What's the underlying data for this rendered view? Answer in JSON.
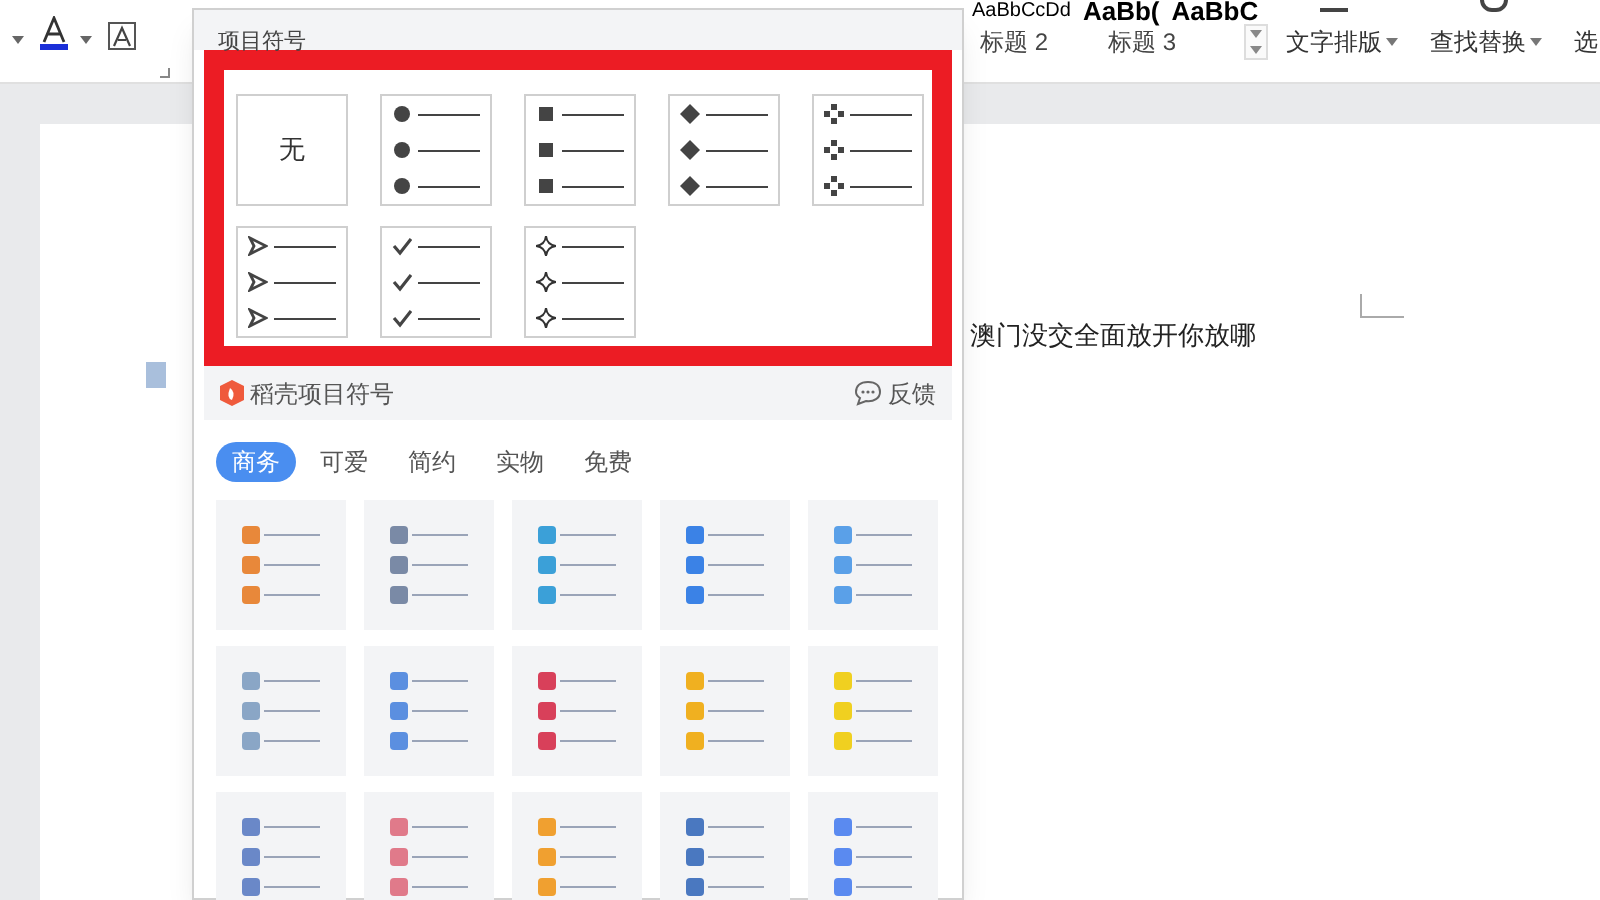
{
  "ribbon": {
    "style_previews": [
      "AaBbCcDd",
      "AaBb(",
      "AaBbC"
    ],
    "style_labels": [
      "标题 2",
      "标题 3"
    ],
    "buttons": [
      {
        "label": "文字排版"
      },
      {
        "label": "查找替换"
      },
      {
        "label": "选"
      }
    ]
  },
  "document": {
    "text": "澳门没交全面放开你放哪"
  },
  "bullet_panel": {
    "title": "项目符号",
    "bullets": [
      {
        "kind": "none",
        "label": "无"
      },
      {
        "kind": "disc"
      },
      {
        "kind": "square"
      },
      {
        "kind": "diamond"
      },
      {
        "kind": "cluster"
      },
      {
        "kind": "arrow"
      },
      {
        "kind": "check"
      },
      {
        "kind": "star"
      }
    ],
    "library": {
      "title": "稻壳项目符号",
      "feedback": "反馈"
    },
    "tabs": [
      {
        "label": "商务",
        "selected": true
      },
      {
        "label": "可爱",
        "selected": false
      },
      {
        "label": "简约",
        "selected": false
      },
      {
        "label": "实物",
        "selected": false
      },
      {
        "label": "免费",
        "selected": false
      }
    ],
    "styles": [
      {
        "color": "#e8883a"
      },
      {
        "color": "#7a8aa6"
      },
      {
        "color": "#3ba0d8"
      },
      {
        "color": "#3b82e6"
      },
      {
        "color": "#5aa0e8"
      },
      {
        "color": "#8aa6c6"
      },
      {
        "color": "#5b8fe0"
      },
      {
        "color": "#d8405a"
      },
      {
        "color": "#f0b020"
      },
      {
        "color": "#f0d020"
      },
      {
        "color": "#6a88c8"
      },
      {
        "color": "#e07a8a"
      },
      {
        "color": "#f0a030"
      },
      {
        "color": "#4a78c0"
      },
      {
        "color": "#5a8af0"
      }
    ]
  }
}
